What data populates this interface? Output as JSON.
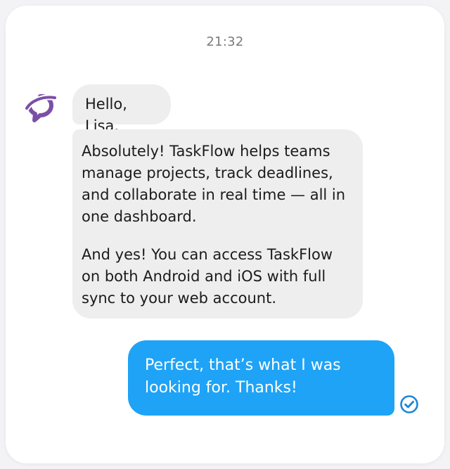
{
  "chat": {
    "timestamp": "21:32",
    "bot": {
      "avatar_icon": "taskflow-chat-logo-icon",
      "avatar_color": "#7b4fa6"
    },
    "messages": [
      {
        "sender": "bot",
        "paragraphs": [
          "Hello, Lisa."
        ]
      },
      {
        "sender": "bot",
        "paragraphs": [
          "Absolutely! TaskFlow helps teams manage projects, track deadlines, and collaborate in real time — all in one dashboard.",
          "And yes! You can access TaskFlow on both Android and iOS with full sync to your web account."
        ]
      },
      {
        "sender": "user",
        "paragraphs": [
          "Perfect, that’s what I was looking for. Thanks!"
        ],
        "status_icon": "read-check-icon"
      }
    ]
  },
  "colors": {
    "bot_bubble": "#eeeeee",
    "user_bubble": "#1ea3f7",
    "check": "#1a86d8"
  }
}
